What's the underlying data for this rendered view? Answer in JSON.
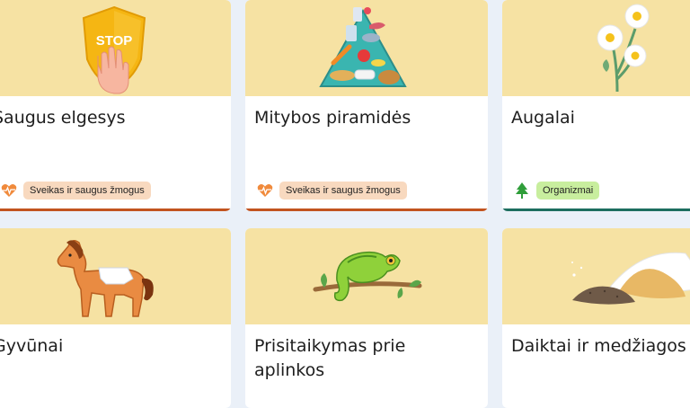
{
  "cards": [
    {
      "title": "Saugus elgesys",
      "tag": "Sveikas ir saugus žmogus",
      "tag_icon": "heart-pulse-icon",
      "art": "stop-shield-hand"
    },
    {
      "title": "Mitybos piramidės",
      "tag": "Sveikas ir saugus žmogus",
      "tag_icon": "heart-pulse-icon",
      "art": "food-pyramid"
    },
    {
      "title": "Augalai",
      "tag": "Organizmai",
      "tag_icon": "tree-icon",
      "art": "chamomile-flowers"
    },
    {
      "title": "Gyvūnai",
      "art": "horse"
    },
    {
      "title_line1": "Prisitaikymas prie",
      "title_line2": "aplinkos",
      "art": "chameleon"
    },
    {
      "title": "Daiktai ir medžiagos",
      "art": "sand-and-soil-piles"
    }
  ],
  "art_text": {
    "stop": "STOP"
  },
  "colors": {
    "card_top": "#f6e2a3",
    "health_bar": "#c2531f",
    "organism_bar": "#1d6e5f",
    "health_tag": "#f8d9bf",
    "organism_tag": "#c8ee9e"
  }
}
